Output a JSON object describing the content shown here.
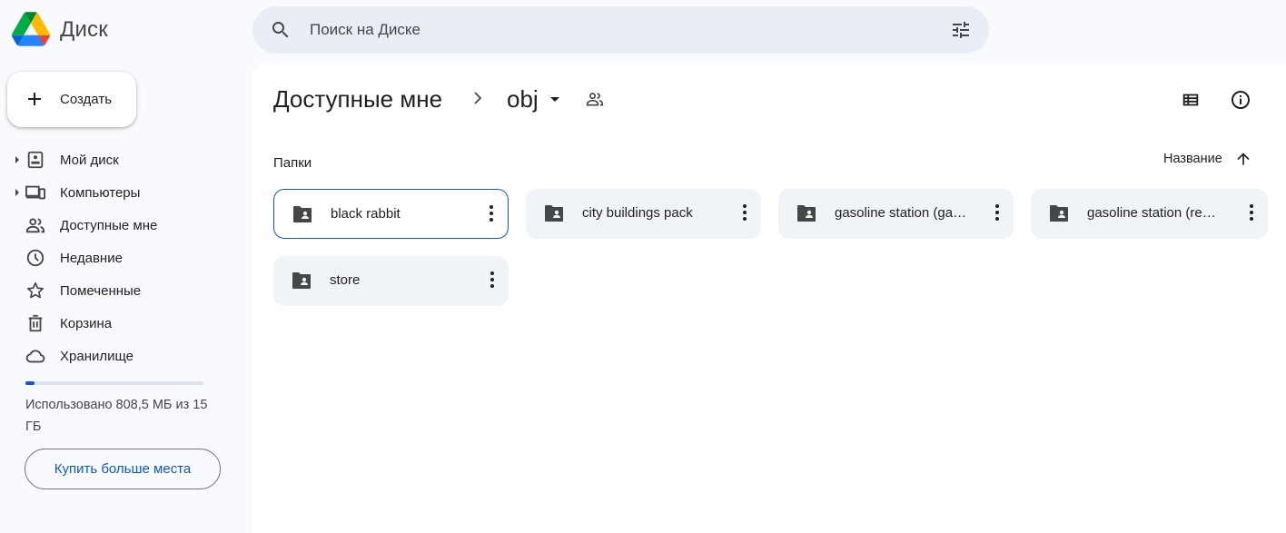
{
  "app": {
    "name": "Диск"
  },
  "search": {
    "placeholder": "Поиск на Диске"
  },
  "sidebar": {
    "create_label": "Создать",
    "items": [
      {
        "label": "Мой диск",
        "icon": "my-drive-icon",
        "expandable": true
      },
      {
        "label": "Компьютеры",
        "icon": "computers-icon",
        "expandable": true
      },
      {
        "label": "Доступные мне",
        "icon": "shared-with-me-icon",
        "expandable": false
      },
      {
        "label": "Недавние",
        "icon": "clock-icon",
        "expandable": false
      },
      {
        "label": "Помеченные",
        "icon": "star-icon",
        "expandable": false
      },
      {
        "label": "Корзина",
        "icon": "trash-icon",
        "expandable": false
      },
      {
        "label": "Хранилище",
        "icon": "cloud-icon",
        "expandable": false
      }
    ],
    "storage": {
      "used_fraction": 0.053,
      "text": "Использовано 808,5 МБ из 15 ГБ"
    },
    "buy_more_label": "Купить больше места"
  },
  "main": {
    "breadcrumb": {
      "parent": "Доступные мне",
      "current": "obj"
    },
    "section_label": "Папки",
    "sort_label": "Название",
    "folders": [
      {
        "name": "black rabbit",
        "selected": true
      },
      {
        "name": "city buildings pack",
        "selected": false
      },
      {
        "name": "gasoline station (gas pack)",
        "selected": false
      },
      {
        "name": "gasoline station (realistic)",
        "selected": false
      },
      {
        "name": "store",
        "selected": false
      }
    ]
  },
  "colors": {
    "accent": "#0b57d0",
    "background": "#f8fafd",
    "search_bg": "#e9eef6",
    "folder_bg": "#f0f4f9"
  }
}
